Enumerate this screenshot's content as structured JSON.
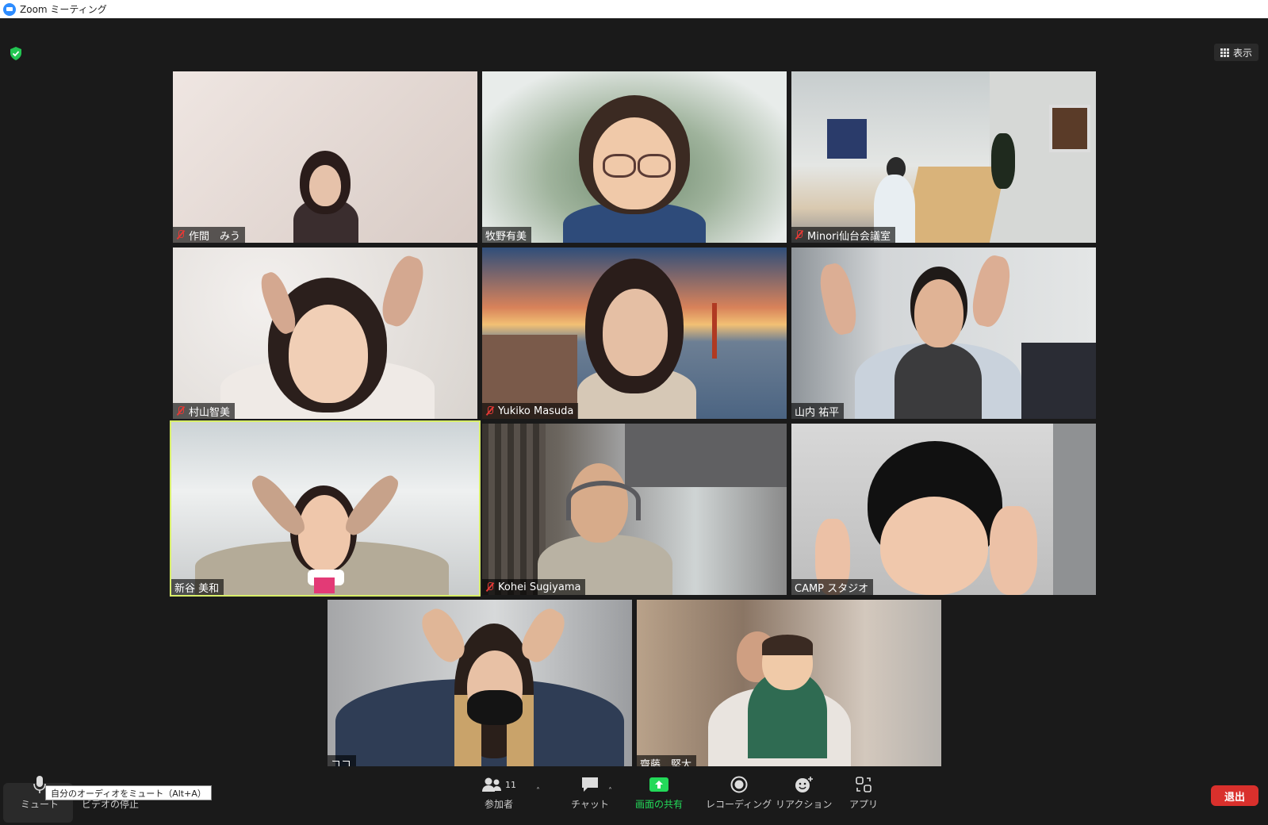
{
  "window": {
    "title": "Zoom ミーティング"
  },
  "header": {
    "view_label": "表示"
  },
  "participants": [
    {
      "name": "作間　みう",
      "muted": true
    },
    {
      "name": "牧野有美",
      "muted": false
    },
    {
      "name": "Minori仙台会議室",
      "muted": true
    },
    {
      "name": "村山智美",
      "muted": true
    },
    {
      "name": "Yukiko Masuda",
      "muted": true
    },
    {
      "name": "山内 祐平",
      "muted": false
    },
    {
      "name": "新谷 美和",
      "muted": false,
      "active_speaker": true
    },
    {
      "name": "Kohei Sugiyama",
      "muted": true
    },
    {
      "name": "CAMP スタジオ",
      "muted": false
    },
    {
      "name": "ココ",
      "muted": false
    },
    {
      "name": "齋藤　堅太",
      "muted": false
    }
  ],
  "toolbar": {
    "mute_label": "ミュート",
    "mute_tooltip": "自分のオーディオをミュート（Alt+A）",
    "video_label": "ビデオの停止",
    "participants_label": "参加者",
    "participants_count": "11",
    "chat_label": "チャット",
    "share_label": "画面の共有",
    "record_label": "レコーディング",
    "reaction_label": "リアクション",
    "apps_label": "アプリ",
    "leave_label": "退出"
  },
  "colors": {
    "share_green": "#23d959",
    "leave_red": "#d9302c",
    "active_border": "#d8ee6a",
    "mute_red": "#e53935"
  }
}
